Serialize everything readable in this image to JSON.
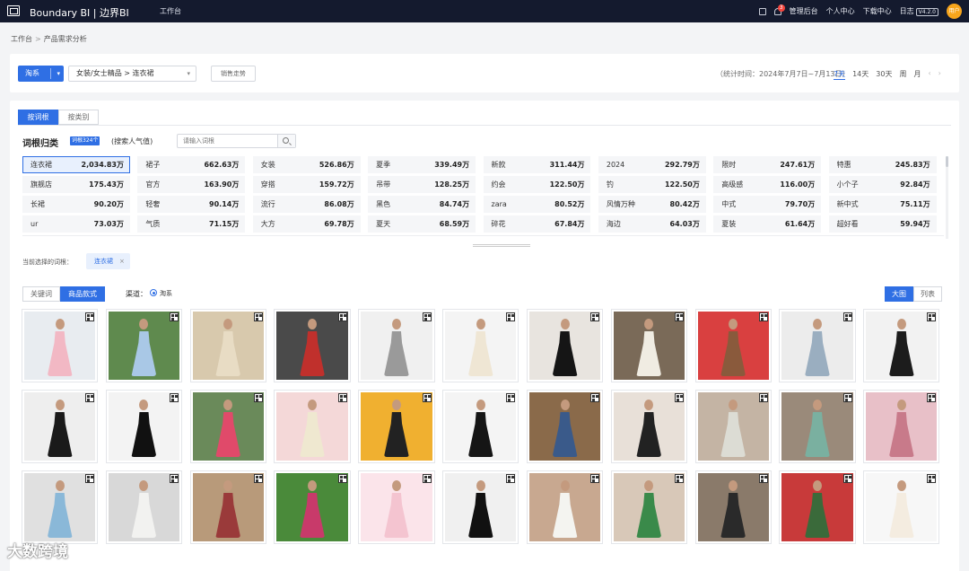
{
  "header": {
    "brand": "Boundary BI | 边界BI",
    "nav_home": "工作台",
    "links": [
      "管理后台",
      "个人中心",
      "下载中心",
      "日志"
    ],
    "notification_count": "3",
    "version": "V4.2.0",
    "avatar_text": "用户"
  },
  "breadcrumb": [
    "工作台",
    "产品需求分析"
  ],
  "filters": {
    "platform": "淘系",
    "category": "女装/女士精品 > 连衣裙",
    "trend_button": "销售走势",
    "stat_time": "（统计时间：2024年7月7日~7月13日）",
    "ranges": [
      "7天",
      "14天",
      "30天",
      "周",
      "月"
    ],
    "active_range": "7天"
  },
  "tabs": {
    "items": [
      "按词根",
      "按类别"
    ],
    "active": "按词根"
  },
  "root_section": {
    "title": "词根归类",
    "count_badge": "词根324个",
    "sort_label": "(搜索人气值)",
    "search_placeholder": "请输入词根",
    "rows": [
      [
        [
          "连衣裙",
          "2,034.83万"
        ],
        [
          "裙子",
          "662.63万"
        ],
        [
          "女装",
          "526.86万"
        ],
        [
          "夏季",
          "339.49万"
        ],
        [
          "新款",
          "311.44万"
        ],
        [
          "2024",
          "292.79万"
        ],
        [
          "限时",
          "247.61万"
        ],
        [
          "特惠",
          "245.83万"
        ]
      ],
      [
        [
          "旗舰店",
          "175.43万"
        ],
        [
          "官方",
          "163.90万"
        ],
        [
          "穿搭",
          "159.72万"
        ],
        [
          "吊带",
          "128.25万"
        ],
        [
          "约会",
          "122.50万"
        ],
        [
          "钓",
          "122.50万"
        ],
        [
          "高级感",
          "116.00万"
        ],
        [
          "小个子",
          "92.84万"
        ]
      ],
      [
        [
          "长裙",
          "90.20万"
        ],
        [
          "轻奢",
          "90.14万"
        ],
        [
          "流行",
          "86.08万"
        ],
        [
          "黑色",
          "84.74万"
        ],
        [
          "zara",
          "80.52万"
        ],
        [
          "风情万种",
          "80.42万"
        ],
        [
          "中式",
          "79.70万"
        ],
        [
          "新中式",
          "75.11万"
        ]
      ],
      [
        [
          "ur",
          "73.03万"
        ],
        [
          "气质",
          "71.15万"
        ],
        [
          "大方",
          "69.78万"
        ],
        [
          "夏天",
          "68.59万"
        ],
        [
          "碎花",
          "67.84万"
        ],
        [
          "海边",
          "64.03万"
        ],
        [
          "夏装",
          "61.64万"
        ],
        [
          "超好看",
          "59.94万"
        ]
      ]
    ],
    "selected": "连衣裙"
  },
  "current": {
    "label": "当前选择的词根：",
    "tag": "连衣裙"
  },
  "view": {
    "tabs": [
      "关键词",
      "商品款式"
    ],
    "active_tab": "商品款式",
    "channel_label": "渠道：",
    "channel": "淘系",
    "layout": [
      "大图",
      "列表"
    ],
    "active_layout": "大图"
  },
  "products": [
    [
      "#f2b8c4",
      "#e8ecf0"
    ],
    [
      "#a9c8e6",
      "#5f8a4e"
    ],
    [
      "#e8dcc4",
      "#d8c9ad"
    ],
    [
      "#c0302c",
      "#4a4a4a"
    ],
    [
      "#9a9a9a",
      "#f0f0f0"
    ],
    [
      "#efe6d4",
      "#f4f4f4"
    ],
    [
      "#151515",
      "#e8e4df"
    ],
    [
      "#f0ece2",
      "#7a6a58"
    ],
    [
      "#8a5a3c",
      "#d94040"
    ],
    [
      "#9aaec0",
      "#ececec"
    ],
    [
      "#1c1c1c",
      "#f2f2f2"
    ],
    [
      "#1a1a1a",
      "#eeeeee"
    ],
    [
      "#111111",
      "#f3f3f3"
    ],
    [
      "#e04a6a",
      "#6a8a5a"
    ],
    [
      "#efe8d0",
      "#f4d8d8"
    ],
    [
      "#222222",
      "#f0b030"
    ],
    [
      "#151515",
      "#f4f4f4"
    ],
    [
      "#3a5a8a",
      "#8a6a4a"
    ],
    [
      "#222222",
      "#e8e0d8"
    ],
    [
      "#dcdcd4",
      "#c4b4a4"
    ],
    [
      "#7ab0a0",
      "#9a8a7a"
    ],
    [
      "#c87a8a",
      "#e8c0c8"
    ],
    [
      "#8ab8d8",
      "#e0e0e0"
    ],
    [
      "#f2f2f0",
      "#d8d8d8"
    ],
    [
      "#9a3a3a",
      "#b89a7a"
    ],
    [
      "#c83a6a",
      "#4a8a3a"
    ],
    [
      "#f4c4d0",
      "#fbe4ea"
    ],
    [
      "#111111",
      "#f0f0f0"
    ],
    [
      "#f4f4f0",
      "#c8a890"
    ],
    [
      "#3a8a4a",
      "#d8c8b8"
    ],
    [
      "#2a2a2a",
      "#8a7a6a"
    ],
    [
      "#3a6a3a",
      "#c83a3a"
    ],
    [
      "#f4ece0",
      "#f7f7f7"
    ]
  ],
  "watermark": "大数跨境"
}
